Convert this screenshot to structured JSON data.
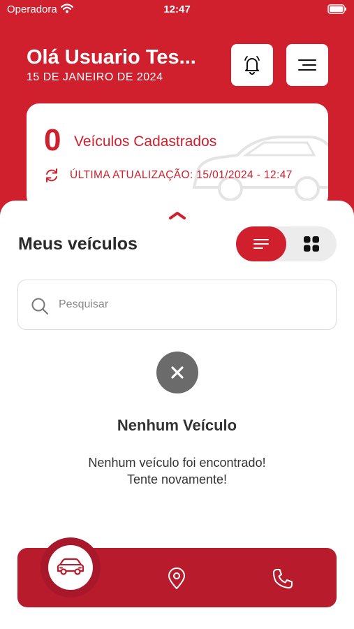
{
  "status_bar": {
    "carrier": "Operadora",
    "time": "12:47"
  },
  "header": {
    "greeting": "Olá Usuario Tes...",
    "date": "15 DE JANEIRO DE 2024",
    "bell_icon": "bell-icon",
    "menu_icon": "hamburger-menu-icon"
  },
  "summary": {
    "count": "0",
    "count_label": "Veículos Cadastrados",
    "last_update": "ÚLTIMA ATUALIZAÇÃO: 15/01/2024 - 12:47"
  },
  "vehicles": {
    "title": "Meus veículos",
    "view_modes": [
      "list",
      "grid"
    ],
    "selected_view": "list",
    "search": {
      "placeholder": "Pesquisar",
      "value": ""
    }
  },
  "empty_state": {
    "title": "Nenhum Veículo",
    "message": "Nenhum veículo foi encontrado! Tente novamente!"
  },
  "bottom_nav": {
    "items": [
      "car-icon",
      "location-pin-icon",
      "phone-icon"
    ],
    "active": "car-icon"
  },
  "colors": {
    "primary": "#d0202e",
    "nav": "#b81c2c",
    "empty_icon": "#6b6b6b"
  }
}
